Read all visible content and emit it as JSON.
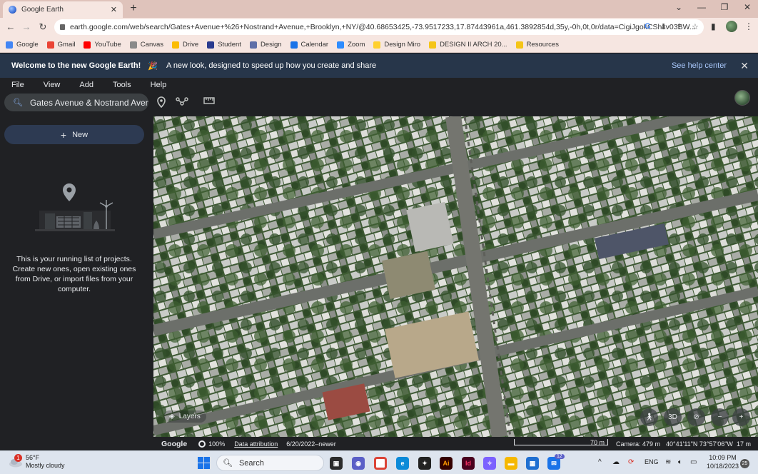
{
  "browser": {
    "tab_title": "Google Earth",
    "tab_close": "✕",
    "new_tab": "+",
    "url": "earth.google.com/web/search/Gates+Avenue+%26+Nostrand+Avenue,+Brooklyn,+NY/@40.68653425,-73.9517233,17.87443961a,461.3892854d,35y,-0h,0t,0r/data=CigiJgokCShxv03BW...",
    "bookmarks": [
      {
        "label": "Google",
        "color": "#4285f4"
      },
      {
        "label": "Gmail",
        "color": "#ea4335"
      },
      {
        "label": "YouTube",
        "color": "#ff0000"
      },
      {
        "label": "Canvas",
        "color": "#8a8a8a"
      },
      {
        "label": "Drive",
        "color": "#fbbc04"
      },
      {
        "label": "Student",
        "color": "#2a3b8f"
      },
      {
        "label": "Design",
        "color": "#5f6fa8"
      },
      {
        "label": "Calendar",
        "color": "#1a73e8"
      },
      {
        "label": "Zoom",
        "color": "#2d8cff"
      },
      {
        "label": "Design Miro",
        "color": "#ffd02f"
      },
      {
        "label": "DESIGN II ARCH 20...",
        "color": "#f5c518"
      },
      {
        "label": "Resources",
        "color": "#f5c518"
      }
    ]
  },
  "banner": {
    "welcome": "Welcome to the new Google Earth!",
    "party_icon": "🎉",
    "message": "A new look, designed to speed up how you create and share",
    "help_link": "See help center",
    "close": "✕"
  },
  "menu": [
    "File",
    "View",
    "Add",
    "Tools",
    "Help"
  ],
  "search": {
    "value": "Gates Avenue & Nostrand Avenue"
  },
  "sidebar": {
    "new_button": "New",
    "new_plus": "+",
    "empty_text": "This is your running list of projects. Create new ones, open existing ones from Drive, or import files from your computer."
  },
  "map": {
    "layers_label": "Layers",
    "controls": {
      "view_3d": "3D",
      "zoom_out": "−",
      "zoom_in": "+"
    }
  },
  "status": {
    "google": "Google",
    "zoom_percent": "100%",
    "attribution": "Data attribution",
    "imagery_date": "6/20/2022–newer",
    "scale": "70 m",
    "camera": "Camera: 479 m",
    "coords": "40°41'11\"N 73°57'06\"W",
    "elevation": "17 m"
  },
  "taskbar": {
    "weather_temp": "56°F",
    "weather_desc": "Mostly cloudy",
    "weather_badge": "1",
    "search_placeholder": "Search",
    "language": "ENG",
    "time": "10:09 PM",
    "date": "10/18/2023",
    "notification_count": "25",
    "mail_badge": "12"
  }
}
